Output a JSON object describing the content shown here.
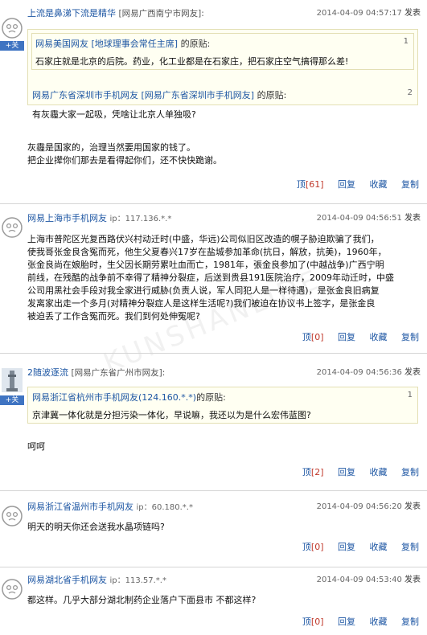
{
  "posts": [
    {
      "username": "上流是鼻涕下流是精华",
      "location": "[网易广西南宁市网友]:",
      "ip": "",
      "time": "2014-04-09 04:57:17",
      "publish": "发表",
      "follow": "+关",
      "quotes": [
        {
          "user": "网易美国网友 [地球理事会常任主席]",
          "suffix": " 的原贴:",
          "num": "1",
          "text": "石家庄就是北京的后院。药业，化工业都是在石家庄，把石家庄空气搞得那么差!"
        },
        {
          "user": "网易广东省深圳市手机网友 [网易广东省深圳市手机网友]",
          "suffix": " 的原贴:",
          "num": "2",
          "text": "有灰霾大家一起吸，凭啥让北京人单独吸?"
        }
      ],
      "body": [
        "灰霾是国家的，治理当然要用国家的钱了。",
        "把企业撵你们那去是看得起你们，还不快快跪谢。"
      ],
      "actions": {
        "top": "顶",
        "top_count": "[61]",
        "reply": "回复",
        "collect": "收藏",
        "copy": "复制"
      }
    },
    {
      "username": "网易上海市手机网友",
      "location": "",
      "ip": "ip：117.136.*.*",
      "time": "2014-04-09 04:56:51",
      "publish": "发表",
      "body": [
        "上海市普陀区光复西路伏兴村动迁时(中盛，华远)公司似旧区改造的幌子胁迫欺骗了我们，",
        "使我哥张金良含冤而死，他生父夏春兴17岁在盐城参加革命(抗日，解放，抗美)，1960年，",
        "张金良尚在娘胎时，生父因长期劳累吐血而亡，1981年，張金良参加了(中越战争)广西宁明",
        "前线，在残酷的战争前不幸得了精神分裂症，后送到贵县191医院治疗，2009年动迁时，中盛",
        "公司用黑社会手段对我全家进行威胁(负责人说，军人同犯人是一样待遇)，是张金良旧病复",
        "发离家出走一个多月(对精神分裂症人是这样生活呢?)我们被迫在协议书上签字，是张金良",
        "被迫丢了工作含冤而死。我们到何处伸冤呢?"
      ],
      "actions": {
        "top": "顶",
        "top_count": "[0]",
        "reply": "回复",
        "collect": "收藏",
        "copy": "复制"
      }
    },
    {
      "username": "2随波逐流",
      "location": "[网易广东省广州市网友]:",
      "ip": "",
      "time": "2014-04-09 04:56:36",
      "publish": "发表",
      "follow": "+关",
      "quotes": [
        {
          "user": "网易浙江省杭州市手机网友(124.160.*.*)",
          "suffix": "的原贴:",
          "num": "1",
          "text": "京津冀一体化就是分担污染一体化，早说嘛，我还以为是什么宏伟蓝图?"
        }
      ],
      "body": [
        "呵呵"
      ],
      "actions": {
        "top": "顶",
        "top_count": "[2]",
        "reply": "回复",
        "collect": "收藏",
        "copy": "复制"
      }
    },
    {
      "username": "网易浙江省温州市手机网友",
      "location": "",
      "ip": "ip：60.180.*.*",
      "time": "2014-04-09 04:56:20",
      "publish": "发表",
      "body": [
        "明天的明天你还会送我水晶项链吗?"
      ],
      "actions": {
        "top": "顶",
        "top_count": "[0]",
        "reply": "回复",
        "collect": "收藏",
        "copy": "复制"
      }
    },
    {
      "username": "网易湖北省手机网友",
      "location": "",
      "ip": "ip：113.57.*.*",
      "time": "2014-04-09 04:53:40",
      "publish": "发表",
      "body": [
        "都这样。几乎大部分湖北制药企业落户下面县市 不都这样?"
      ],
      "actions": {
        "top": "顶",
        "top_count": "[0]",
        "reply": "回复",
        "collect": "收藏",
        "copy": "复制"
      }
    }
  ],
  "watermark": "KUNSHANLIDE"
}
